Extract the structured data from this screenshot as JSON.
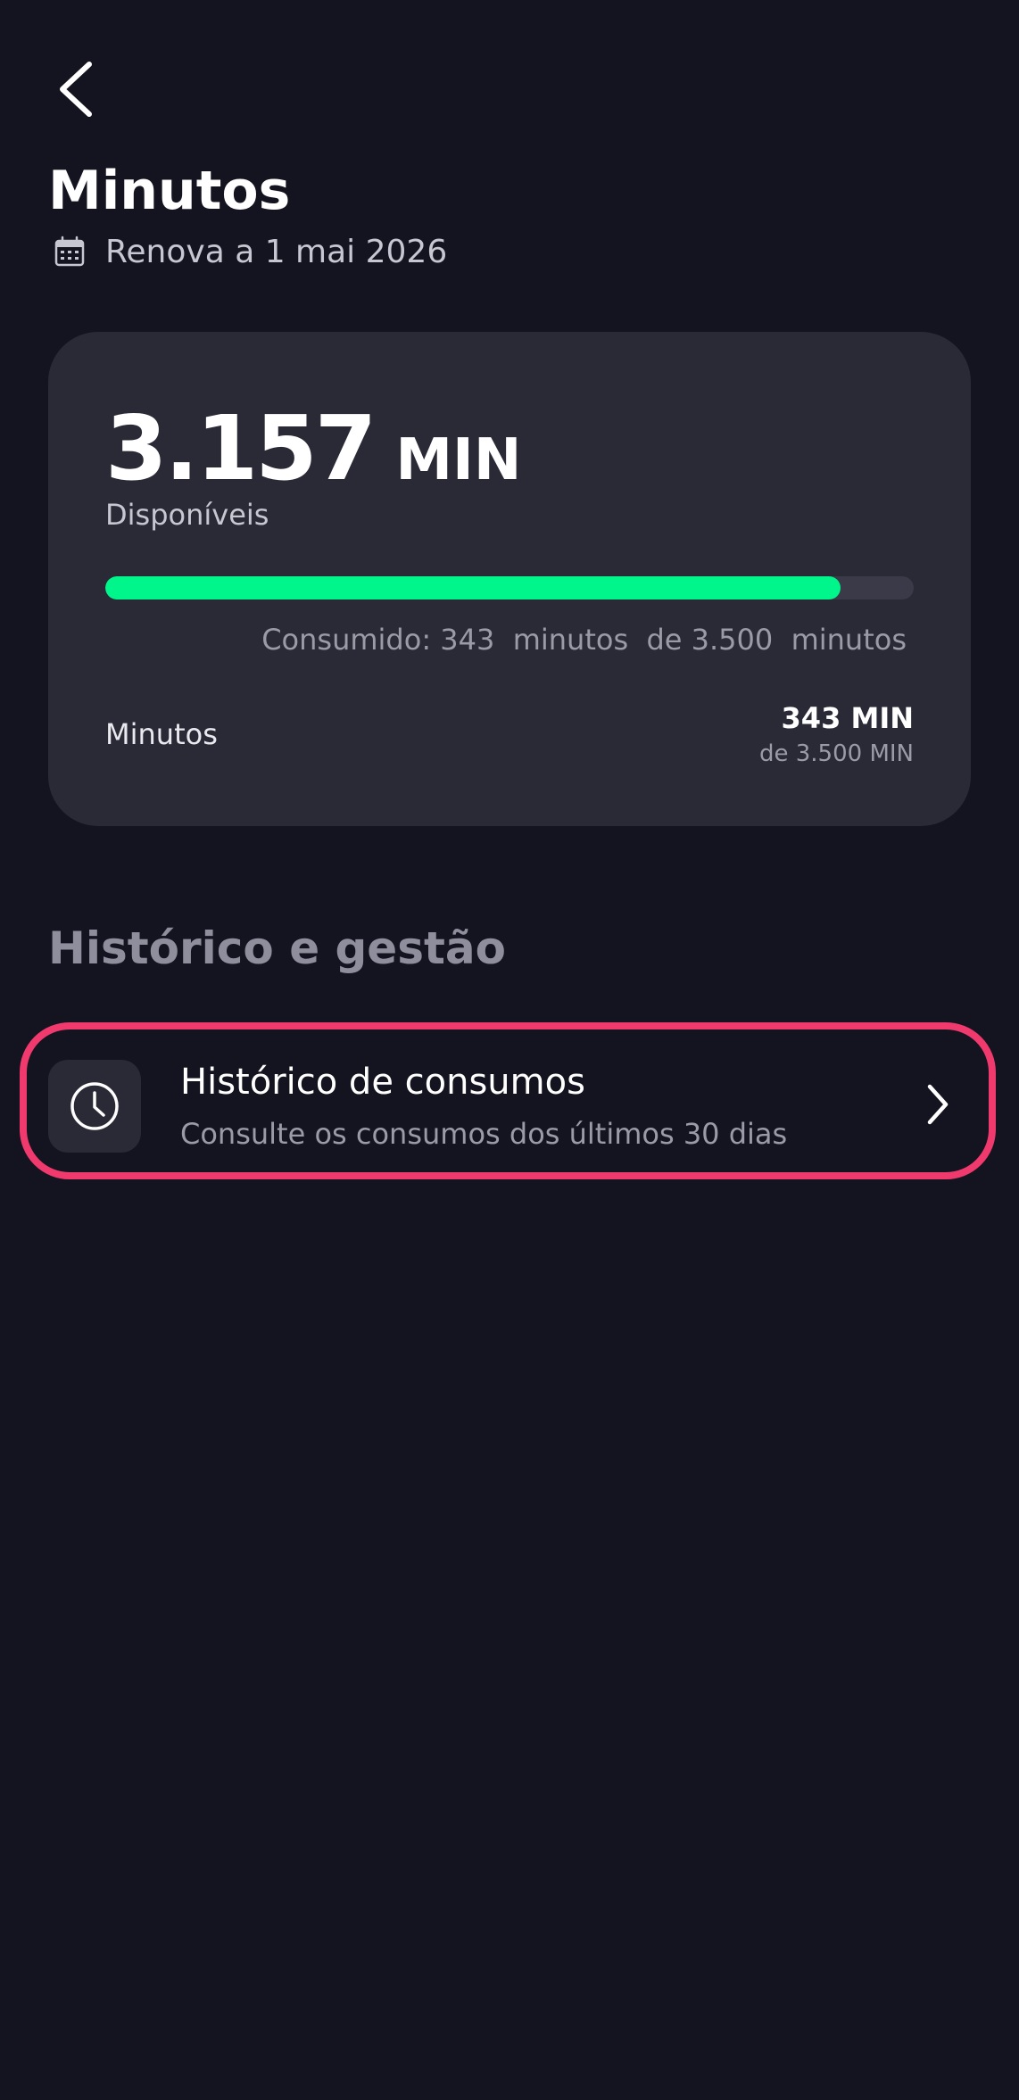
{
  "header": {
    "title": "Minutos",
    "renewal": "Renova a 1 mai 2026"
  },
  "balance_card": {
    "amount": "3.157",
    "unit": "MIN",
    "available_label": "Disponíveis",
    "progress_fraction": 0.91,
    "consumed_text": "Consumido: 343  minutos  de 3.500  minutos",
    "row_label": "Minutos",
    "used": "343 MIN",
    "total": "de 3.500 MIN"
  },
  "section": {
    "title": "Histórico e gestão"
  },
  "history_item": {
    "title": "Histórico de consumos",
    "subtitle": "Consulte os consumos dos últimos 30 dias"
  },
  "colors": {
    "background": "#141421",
    "card": "#2a2a37",
    "progress": "#00f58a",
    "highlight": "#f03a6e"
  },
  "icons": {
    "back": "chevron-left-icon",
    "calendar": "calendar-icon",
    "history": "clock-icon",
    "open": "chevron-right-icon"
  }
}
